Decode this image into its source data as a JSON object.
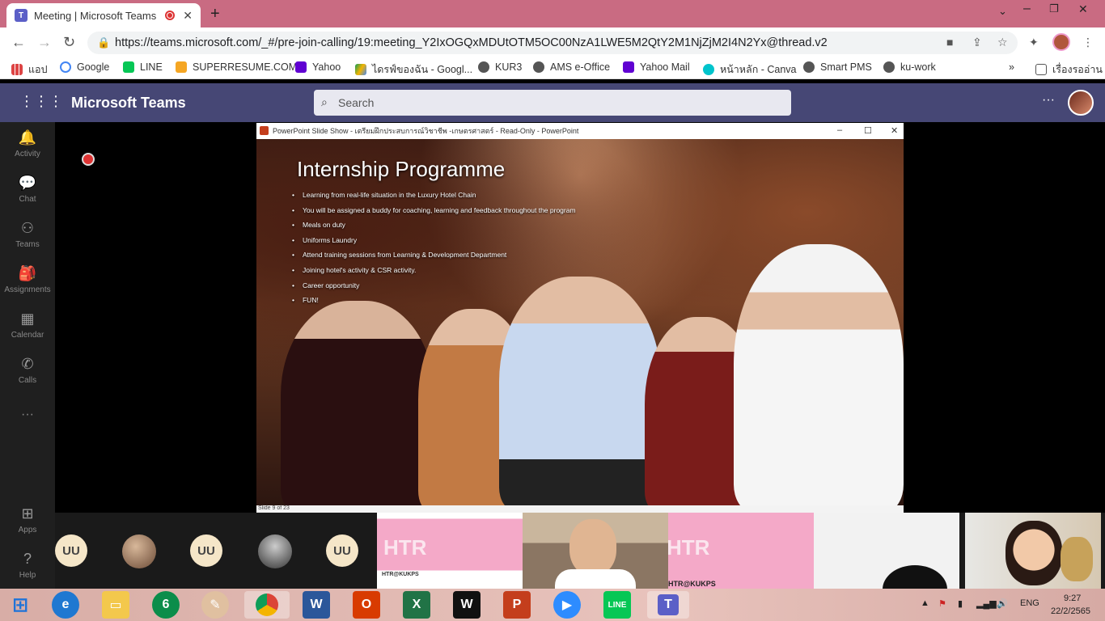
{
  "browser": {
    "tab_title": "Meeting | Microsoft Teams",
    "url": "https://teams.microsoft.com/_#/pre-join-calling/19:meeting_Y2IxOGQxMDUtOTM5OC00NzA1LWE5M2QtY2M1NjZjM2I4N2Yx@thread.v2",
    "bookmarks": [
      "แอป",
      "Google",
      "LINE",
      "SUPERRESUME.COM",
      "Yahoo",
      "ไดรฟ์ของฉัน - Googl...",
      "KUR3",
      "AMS e-Office",
      "Yahoo Mail",
      "หน้าหลัก - Canva",
      "Smart PMS",
      "ku-work"
    ],
    "reading_list": "เรื่องรออ่าน"
  },
  "teams": {
    "title": "Microsoft Teams",
    "search_placeholder": "Search",
    "nav": [
      "Activity",
      "Chat",
      "Teams",
      "Assignments",
      "Calendar",
      "Calls",
      "Apps",
      "Help"
    ]
  },
  "ppt": {
    "window_title": "PowerPoint Slide Show - เตรียมฝึกประสบการณ์วิชาชีพ -เกษตรศาสตร์ - Read-Only - PowerPoint",
    "slide_title": "Internship Programme",
    "bullets": [
      "Learning from real-life situation in the Luxury Hotel Chain",
      "You will be assigned a buddy for coaching, learning and feedback throughout the program",
      "Meals on duty",
      "Uniforms Laundry",
      "Attend training sessions from Learning & Development Department",
      "Joining hotel's activity & CSR activity.",
      "Career opportunity",
      "FUN!"
    ],
    "status": "Slide 9 of 23"
  },
  "participants": {
    "initials": "UU",
    "tile_text": "HTR",
    "tile_caption": "HTR@KUKPS"
  },
  "taskbar": {
    "lang": "ENG",
    "time": "9:27",
    "date": "22/2/2565"
  }
}
